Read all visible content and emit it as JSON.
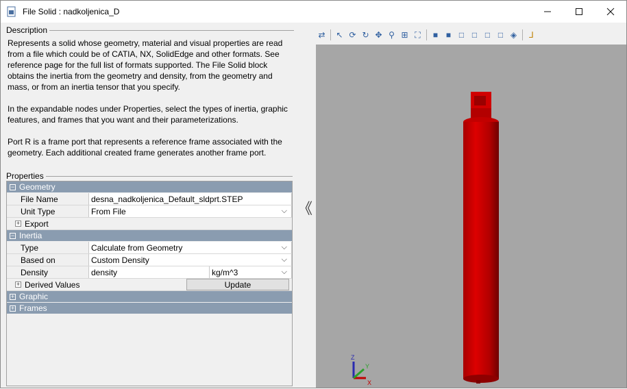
{
  "window": {
    "title": "File Solid : nadkoljenica_D",
    "controls": [
      "—",
      "☐",
      "✕"
    ]
  },
  "description": {
    "label": "Description",
    "paragraphs": [
      "Represents a solid whose geometry, material and visual properties are read from a file which could be of CATIA, NX, SolidEdge and other formats. See reference page for the full list of formats supported. The File Solid block obtains the inertia from the geometry and density, from the geometry and mass, or from an inertia tensor that you specify.",
      "In the expandable nodes under Properties, select the types of inertia, graphic features, and frames that you want and their parameterizations.",
      "Port R is a frame port that represents a reference frame associated with the geometry. Each additional created frame generates another frame port."
    ]
  },
  "properties": {
    "label": "Properties",
    "geometry": {
      "header": "Geometry",
      "file_name_label": "File Name",
      "file_name_value": "desna_nadkoljenica_Default_sldprt.STEP",
      "unit_type_label": "Unit Type",
      "unit_type_value": "From File",
      "export_label": "Export"
    },
    "inertia": {
      "header": "Inertia",
      "type_label": "Type",
      "type_value": "Calculate from Geometry",
      "based_on_label": "Based on",
      "based_on_value": "Custom Density",
      "density_label": "Density",
      "density_value": "density",
      "density_unit": "kg/m^3",
      "derived_label": "Derived Values",
      "update_label": "Update"
    },
    "graphic_header": "Graphic",
    "frames_header": "Frames"
  },
  "viewer": {
    "collapse_glyph": "《",
    "axis_labels": {
      "z": "Z",
      "y": "Y",
      "x": "X"
    },
    "colors": {
      "background": "#a6a6a6",
      "solid": "#cc0000"
    }
  }
}
